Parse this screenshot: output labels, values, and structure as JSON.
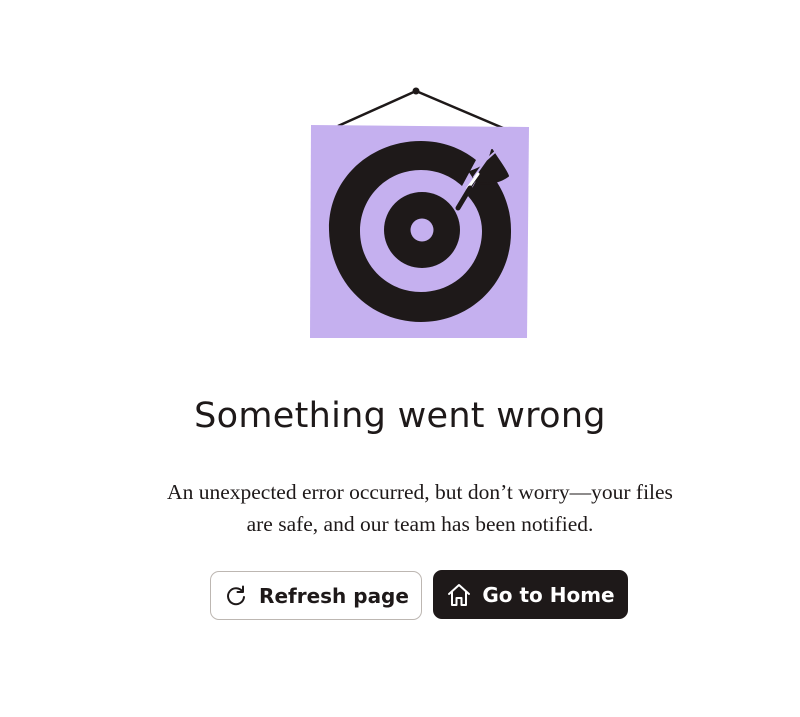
{
  "error": {
    "title": "Something went wrong",
    "message_line1": "An unexpected error occurred, but don’t worry—your files",
    "message_line2": "are safe, and our team has been notified."
  },
  "actions": {
    "refresh_label": "Refresh page",
    "refresh_icon": "refresh-icon",
    "home_label": "Go to Home",
    "home_icon": "home-icon"
  },
  "illustration": {
    "name": "missed-target-poster",
    "colors": {
      "poster": "#c5b0ef",
      "ink": "#1e1919"
    }
  },
  "colors": {
    "text": "#1e1919",
    "primary_button": "#1e1919",
    "secondary_border": "#bdb7b2",
    "background": "#ffffff"
  }
}
